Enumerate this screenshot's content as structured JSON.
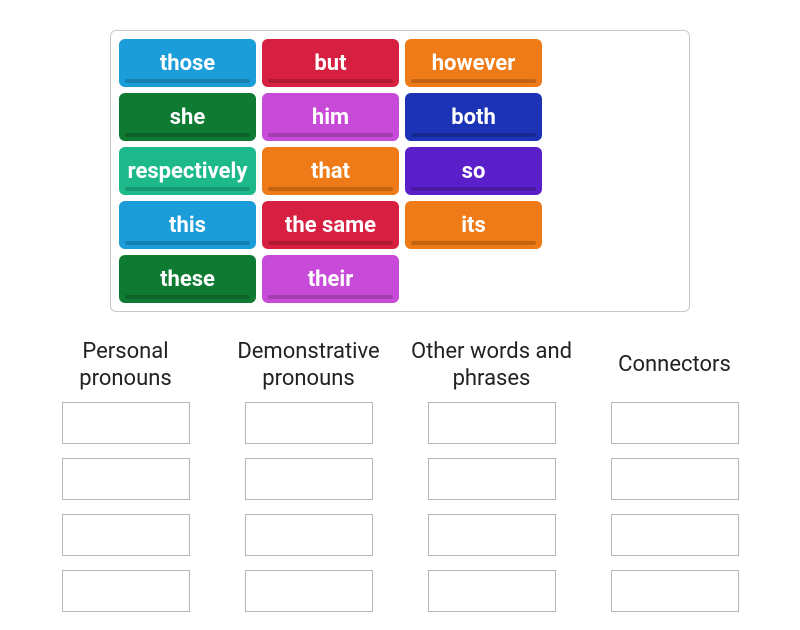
{
  "tiles": [
    {
      "label": "those",
      "color": "#1a9dd9"
    },
    {
      "label": "but",
      "color": "#d72041"
    },
    {
      "label": "however",
      "color": "#ee7b18"
    },
    {
      "label": "she",
      "color": "#0f7a32"
    },
    {
      "label": "him",
      "color": "#c74ad8"
    },
    {
      "label": "both",
      "color": "#1b33b4"
    },
    {
      "label": "respectively",
      "color": "#1db98a"
    },
    {
      "label": "that",
      "color": "#ee7b18"
    },
    {
      "label": "so",
      "color": "#5b1fc9"
    },
    {
      "label": "this",
      "color": "#1a9dd9"
    },
    {
      "label": "the same",
      "color": "#d72041"
    },
    {
      "label": "its",
      "color": "#ee7b18"
    },
    {
      "label": "these",
      "color": "#0f7a32"
    },
    {
      "label": "their",
      "color": "#c74ad8"
    }
  ],
  "categories": [
    {
      "title": "Personal pronouns",
      "slots": 4
    },
    {
      "title": "Demonstrative pronouns",
      "slots": 4
    },
    {
      "title": "Other words and phrases",
      "slots": 4
    },
    {
      "title": "Connectors",
      "slots": 4
    }
  ]
}
